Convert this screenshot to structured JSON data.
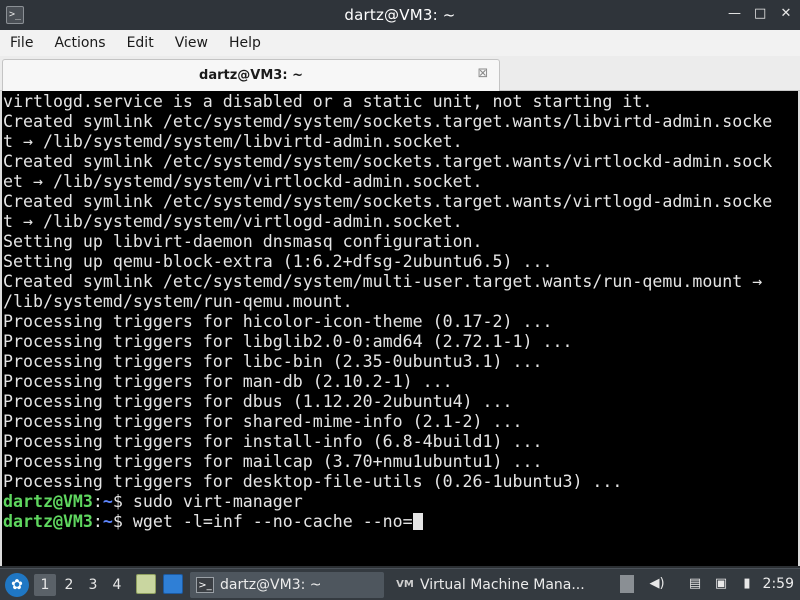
{
  "window": {
    "app_icon_glyph": ">_",
    "title": "dartz@VM3: ~",
    "buttons": {
      "minimize": "—",
      "maximize": "□",
      "close": "✕"
    }
  },
  "menu": [
    "File",
    "Actions",
    "Edit",
    "View",
    "Help"
  ],
  "tab": {
    "label": "dartz@VM3: ~",
    "close_glyph": "⊠"
  },
  "terminal": {
    "lines": [
      "virtlogd.service is a disabled or a static unit, not starting it.",
      "Created symlink /etc/systemd/system/sockets.target.wants/libvirtd-admin.socke",
      "t → /lib/systemd/system/libvirtd-admin.socket.",
      "Created symlink /etc/systemd/system/sockets.target.wants/virtlockd-admin.sock",
      "et → /lib/systemd/system/virtlockd-admin.socket.",
      "Created symlink /etc/systemd/system/sockets.target.wants/virtlogd-admin.socke",
      "t → /lib/systemd/system/virtlogd-admin.socket.",
      "Setting up libvirt-daemon dnsmasq configuration.",
      "Setting up qemu-block-extra (1:6.2+dfsg-2ubuntu6.5) ...",
      "Created symlink /etc/systemd/system/multi-user.target.wants/run-qemu.mount →",
      "/lib/systemd/system/run-qemu.mount.",
      "Processing triggers for hicolor-icon-theme (0.17-2) ...",
      "Processing triggers for libglib2.0-0:amd64 (2.72.1-1) ...",
      "Processing triggers for libc-bin (2.35-0ubuntu3.1) ...",
      "Processing triggers for man-db (2.10.2-1) ...",
      "Processing triggers for dbus (1.12.20-2ubuntu4) ...",
      "Processing triggers for shared-mime-info (2.1-2) ...",
      "Processing triggers for install-info (6.8-4build1) ...",
      "Processing triggers for mailcap (3.70+nmu1ubuntu1) ...",
      "Processing triggers for desktop-file-utils (0.26-1ubuntu3) ..."
    ],
    "prompts": [
      {
        "user": "dartz@VM3",
        "sep": ":",
        "path": "~",
        "symbol": "$",
        "command": " sudo virt-manager"
      },
      {
        "user": "dartz@VM3",
        "sep": ":",
        "path": "~",
        "symbol": "$",
        "command": " wget -l=inf --no-cache --no="
      }
    ]
  },
  "taskbar": {
    "start_glyph": "✿",
    "workspaces": [
      "1",
      "2",
      "3",
      "4"
    ],
    "active_workspace": "1",
    "tasks": [
      {
        "icon": ">_",
        "label": "dartz@VM3: ~"
      },
      {
        "icon": "VM",
        "label": "Virtual Machine Mana..."
      }
    ],
    "tray": {
      "volume_glyph": "◀)",
      "clipboard_glyph": "▤",
      "network_glyph": "▣",
      "battery_glyph": "▮"
    },
    "clock": "2:59"
  },
  "colors": {
    "terminal_bg": "#000000",
    "terminal_fg": "#e5e5e5",
    "prompt_user": "#5fd75f",
    "prompt_path": "#5f87ff",
    "titlebar_bg": "#2f343a",
    "taskbar_bg": "#343a40"
  }
}
